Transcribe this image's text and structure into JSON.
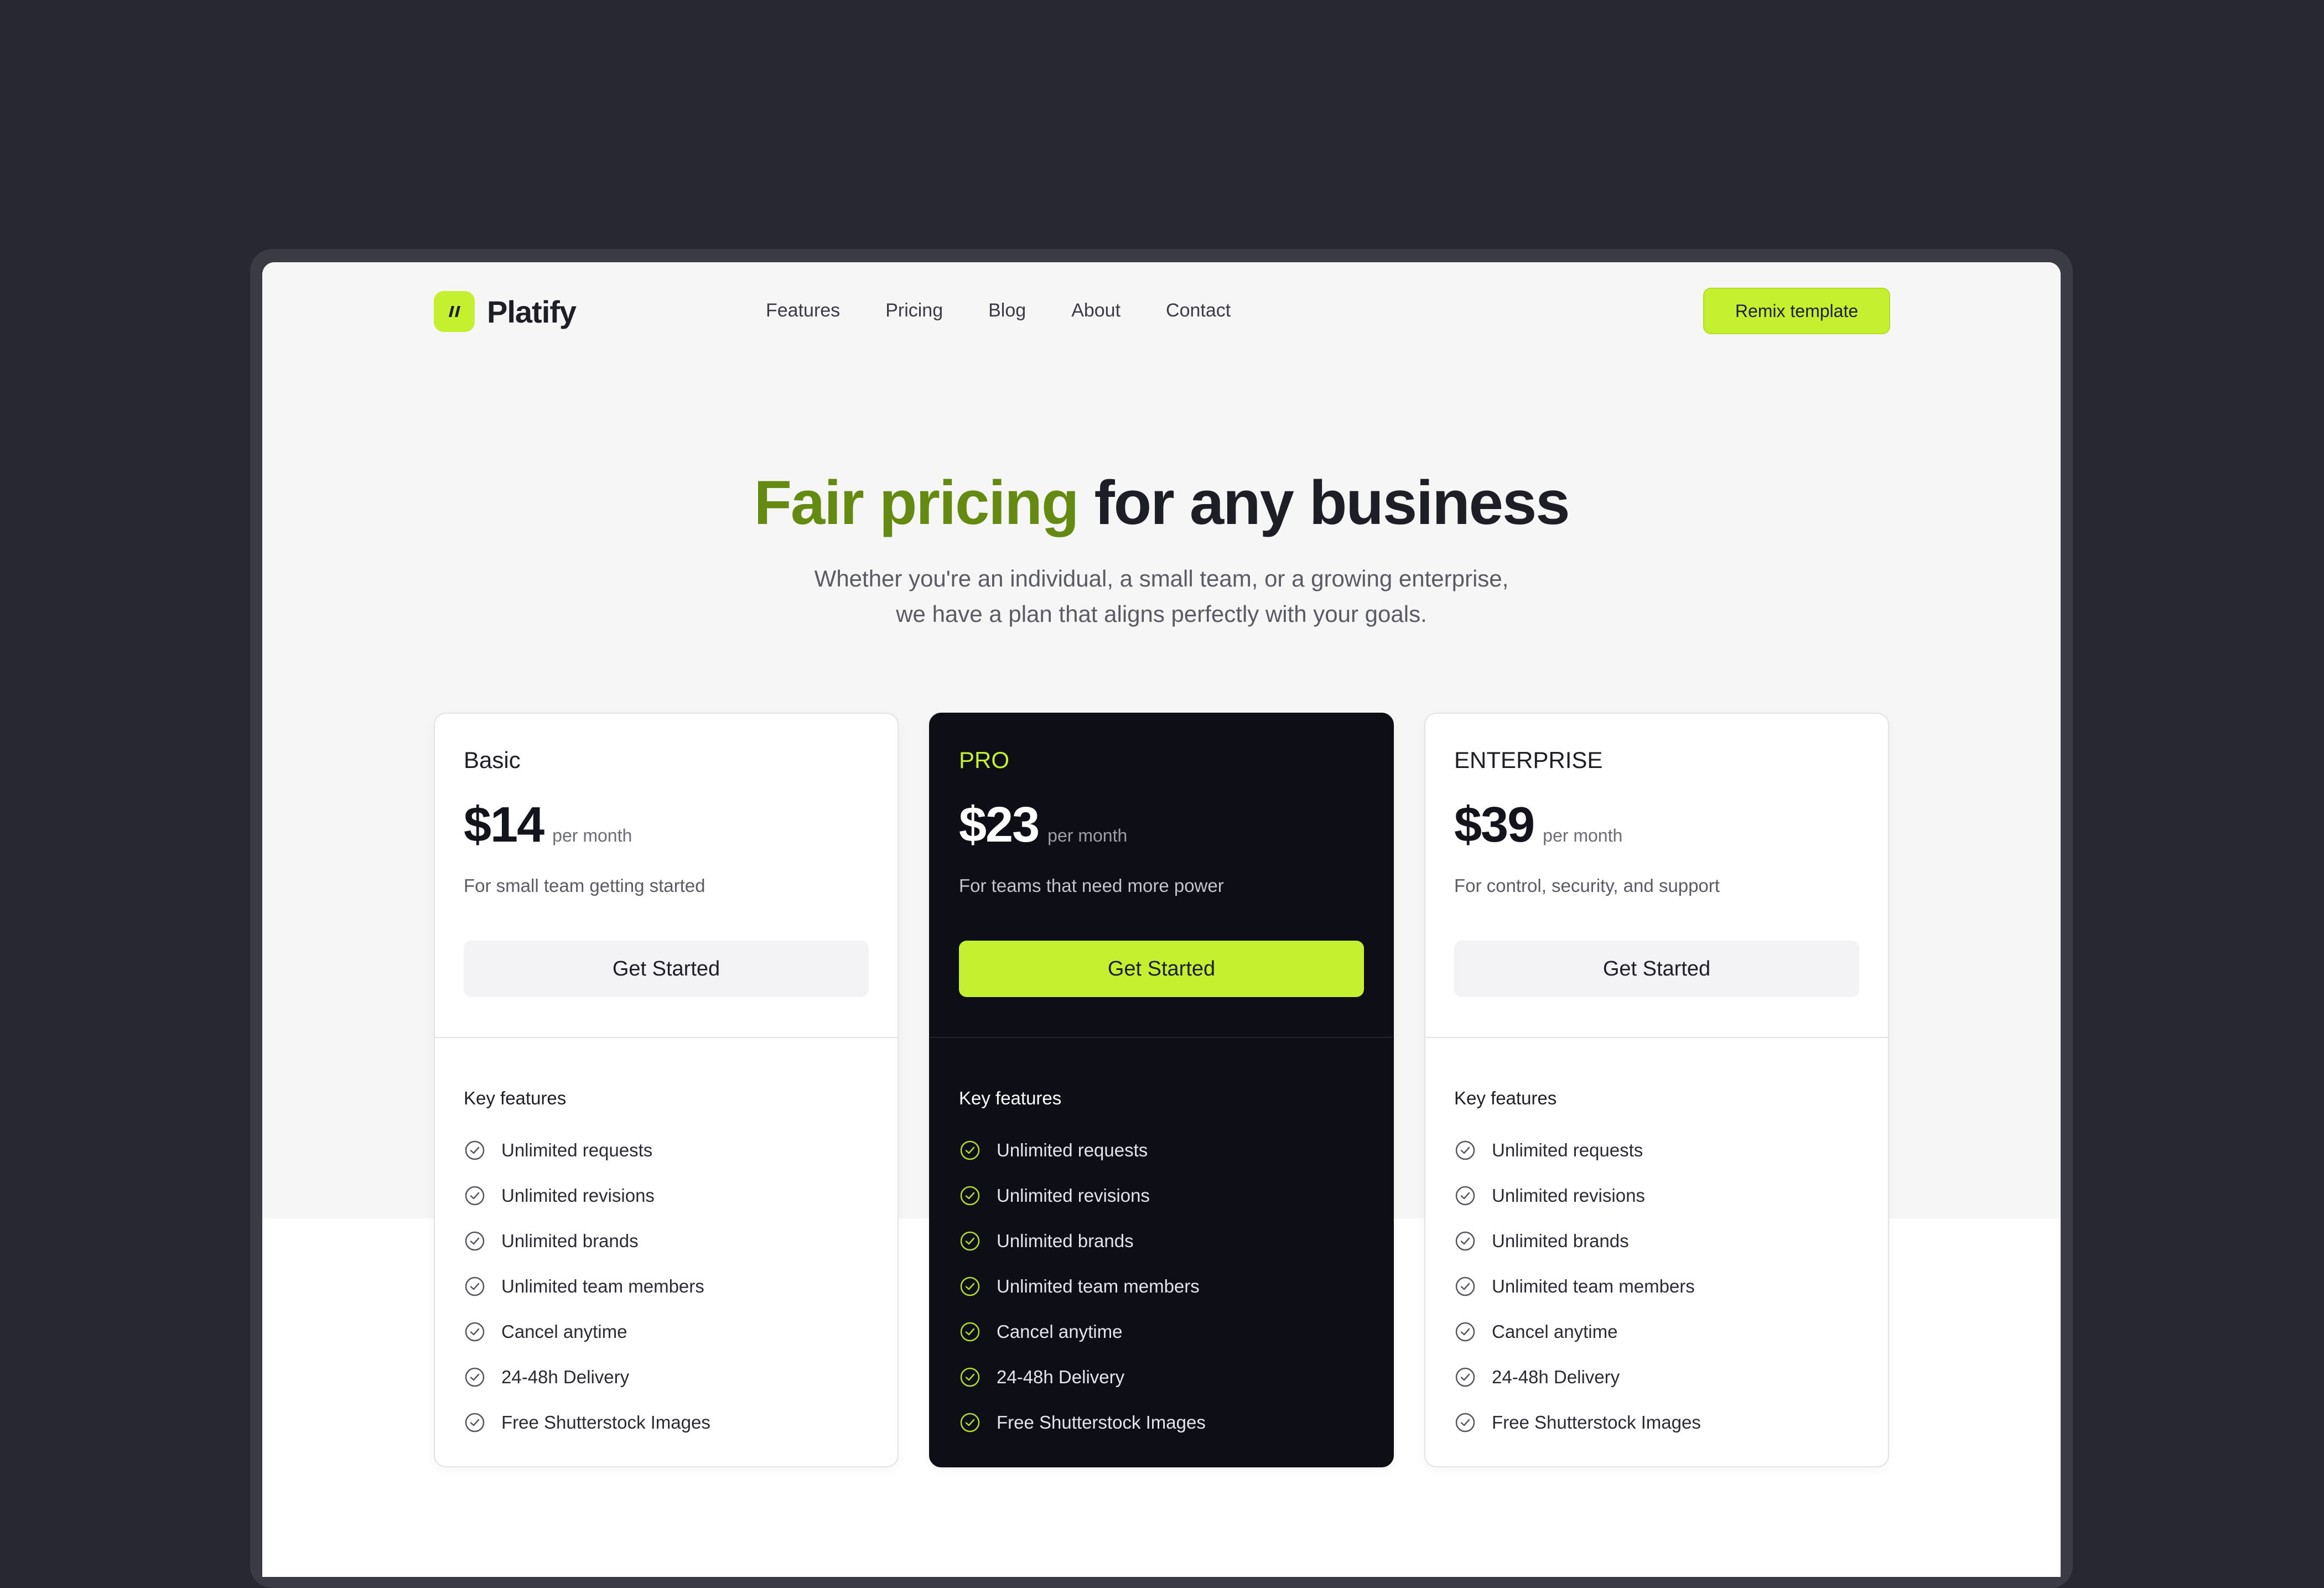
{
  "brand": {
    "name": "Platify"
  },
  "nav": {
    "links": [
      "Features",
      "Pricing",
      "Blog",
      "About",
      "Contact"
    ],
    "cta": "Remix template"
  },
  "hero": {
    "title_accent": "Fair pricing",
    "title_rest": " for any business",
    "subtitle_line1": "Whether you're an individual, a small team, or a growing enterprise,",
    "subtitle_line2": "we have a plan that aligns perfectly with your goals."
  },
  "plans": [
    {
      "name": "Basic",
      "price": "$14",
      "period": "per month",
      "description": "For small team getting started",
      "cta": "Get Started",
      "features_heading": "Key features",
      "features": [
        "Unlimited requests",
        "Unlimited revisions",
        "Unlimited brands",
        "Unlimited team members",
        "Cancel anytime",
        "24-48h Delivery",
        "Free Shutterstock Images"
      ]
    },
    {
      "name": "PRO",
      "price": "$23",
      "period": "per month",
      "description": "For teams that need more power",
      "cta": "Get Started",
      "features_heading": "Key features",
      "features": [
        "Unlimited requests",
        "Unlimited revisions",
        "Unlimited brands",
        "Unlimited team members",
        "Cancel anytime",
        "24-48h Delivery",
        "Free Shutterstock Images"
      ]
    },
    {
      "name": "ENTERPRISE",
      "price": "$39",
      "period": "per month",
      "description": "For control, security, and support",
      "cta": "Get Started",
      "features_heading": "Key features",
      "features": [
        "Unlimited requests",
        "Unlimited revisions",
        "Unlimited brands",
        "Unlimited team members",
        "Cancel anytime",
        "24-48h Delivery",
        "Free Shutterstock Images"
      ]
    }
  ],
  "colors": {
    "accent": "#c5f02f",
    "accent_text": "#648a12",
    "dark_card": "#0d0e16",
    "background": "#272831"
  },
  "icons": {
    "logo": "logo-mark-icon",
    "feature": "check-circle-icon"
  }
}
